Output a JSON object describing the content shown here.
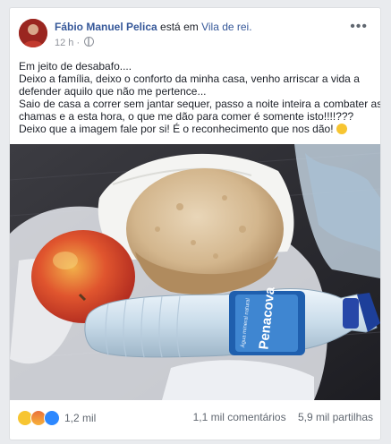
{
  "post": {
    "author": "Fábio Manuel Pelica",
    "connector": "está em",
    "location": "Vila de rei.",
    "time": "12 h",
    "more_label": "•••",
    "lines": [
      "Em jeito de desabafo....",
      "Deixo a família, deixo o conforto da minha casa, venho arriscar a vida a",
      "defender aquilo que não me pertence...",
      "Saio de casa a correr sem jantar sequer, passo a noite inteira a combater as",
      "chamas e a esta hora, o que me dão para comer é somente isto!!!!???",
      "Deixo que a imagem fale por si! É o reconhecimento que nos dão!"
    ]
  },
  "photo": {
    "bottle_brand": "Penacova",
    "bottle_sub": "Água mineral natural"
  },
  "footer": {
    "reactions": [
      "sad-icon",
      "angry-icon",
      "like-icon"
    ],
    "reaction_count": "1,2 mil",
    "comments": "1,1 mil comentários",
    "shares": "5,9 mil partilhas"
  }
}
